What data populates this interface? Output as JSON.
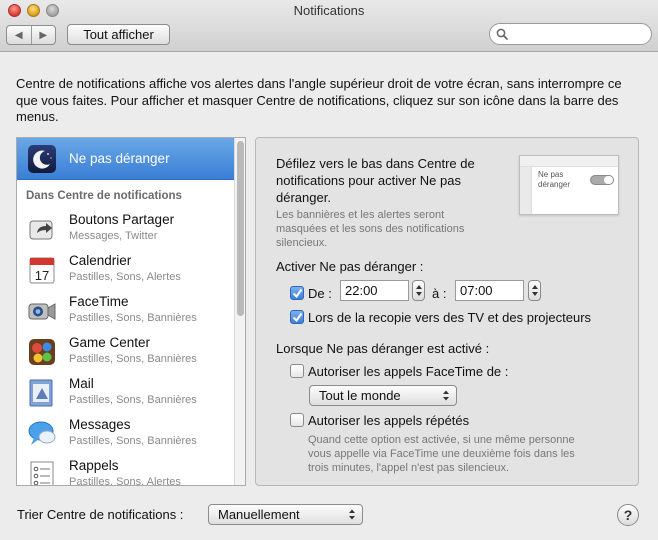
{
  "window": {
    "title": "Notifications"
  },
  "toolbar": {
    "back_glyph": "◀",
    "forward_glyph": "▶",
    "show_all_label": "Tout afficher",
    "search_value": ""
  },
  "description": "Centre de notifications affiche vos alertes dans l'angle supérieur droit de votre écran, sans interrompre ce que vous faites. Pour afficher et masquer Centre de notifications, cliquez sur son icône dans la barre des menus.",
  "sidebar": {
    "selected_label": "Ne pas déranger",
    "section_header": "Dans Centre de notifications",
    "apps": [
      {
        "name": "Boutons Partager",
        "detail": "Messages, Twitter",
        "icon": "share-icon"
      },
      {
        "name": "Calendrier",
        "detail": "Pastilles, Sons, Alertes",
        "icon": "calendar-icon"
      },
      {
        "name": "FaceTime",
        "detail": "Pastilles, Sons, Bannières",
        "icon": "facetime-icon"
      },
      {
        "name": "Game Center",
        "detail": "Pastilles, Sons, Bannières",
        "icon": "game-center-icon"
      },
      {
        "name": "Mail",
        "detail": "Pastilles, Sons, Bannières",
        "icon": "mail-icon"
      },
      {
        "name": "Messages",
        "detail": "Pastilles, Sons, Bannières",
        "icon": "messages-icon"
      },
      {
        "name": "Rappels",
        "detail": "Pastilles, Sons, Alertes",
        "icon": "reminders-icon"
      }
    ],
    "calendar_day": "17"
  },
  "dnd": {
    "intro_line1": "Défilez vers le bas dans Centre de",
    "intro_line2": "notifications pour activer Ne pas",
    "intro_line3": "déranger.",
    "note_line1": "Les bannières et les alertes seront",
    "note_line2": "masquées et les sons des notifications",
    "note_line3": "silencieux.",
    "preview_label_line1": "Ne pas",
    "preview_label_line2": "déranger",
    "activate_header": "Activer Ne pas déranger :",
    "from_label": "De :",
    "from_checked": true,
    "from_time": "22:00",
    "to_label": "à :",
    "to_time": "07:00",
    "mirroring_label": "Lors de la recopie vers des TV et des projecteurs",
    "mirroring_checked": true,
    "when_active_header": "Lorsque Ne pas déranger est activé :",
    "facetime_calls_label": "Autoriser les appels FaceTime de :",
    "facetime_calls_checked": false,
    "facetime_from_value": "Tout le monde",
    "repeated_calls_label": "Autoriser les appels répétés",
    "repeated_calls_checked": false,
    "repeated_note_line1": "Quand cette option est activée, si une même personne",
    "repeated_note_line2": "vous appelle via FaceTime une deuxième fois dans les",
    "repeated_note_line3": "trois minutes, l'appel n'est pas silencieux."
  },
  "footer": {
    "sort_label": "Trier Centre de notifications :",
    "sort_value": "Manuellement",
    "help_glyph": "?"
  }
}
